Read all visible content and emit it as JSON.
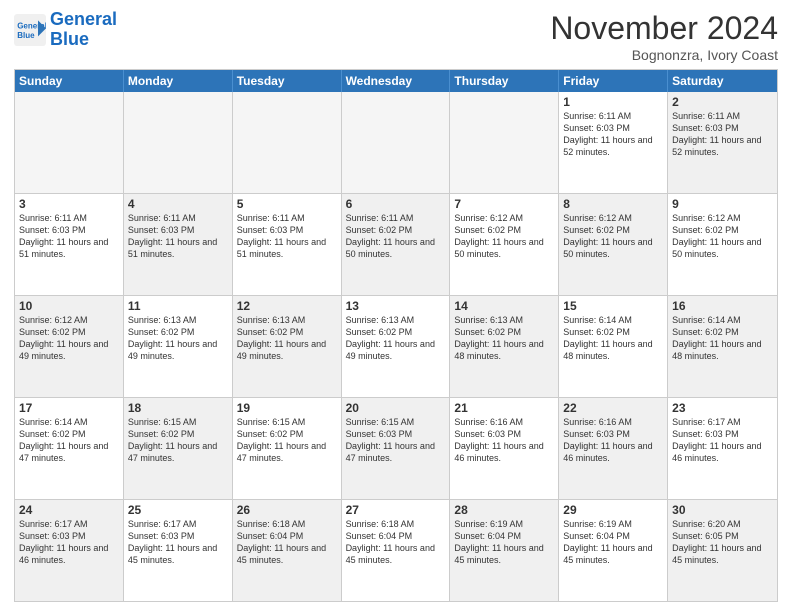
{
  "header": {
    "logo_line1": "General",
    "logo_line2": "Blue",
    "month_title": "November 2024",
    "location": "Bognonzra, Ivory Coast"
  },
  "weekdays": [
    "Sunday",
    "Monday",
    "Tuesday",
    "Wednesday",
    "Thursday",
    "Friday",
    "Saturday"
  ],
  "rows": [
    [
      {
        "day": "",
        "empty": true
      },
      {
        "day": "",
        "empty": true
      },
      {
        "day": "",
        "empty": true
      },
      {
        "day": "",
        "empty": true
      },
      {
        "day": "",
        "empty": true
      },
      {
        "day": "1",
        "sunrise": "6:11 AM",
        "sunset": "6:03 PM",
        "daylight": "11 hours and 52 minutes."
      },
      {
        "day": "2",
        "sunrise": "6:11 AM",
        "sunset": "6:03 PM",
        "daylight": "11 hours and 52 minutes.",
        "shaded": true
      }
    ],
    [
      {
        "day": "3",
        "sunrise": "6:11 AM",
        "sunset": "6:03 PM",
        "daylight": "11 hours and 51 minutes."
      },
      {
        "day": "4",
        "sunrise": "6:11 AM",
        "sunset": "6:03 PM",
        "daylight": "11 hours and 51 minutes.",
        "shaded": true
      },
      {
        "day": "5",
        "sunrise": "6:11 AM",
        "sunset": "6:03 PM",
        "daylight": "11 hours and 51 minutes."
      },
      {
        "day": "6",
        "sunrise": "6:11 AM",
        "sunset": "6:02 PM",
        "daylight": "11 hours and 50 minutes.",
        "shaded": true
      },
      {
        "day": "7",
        "sunrise": "6:12 AM",
        "sunset": "6:02 PM",
        "daylight": "11 hours and 50 minutes."
      },
      {
        "day": "8",
        "sunrise": "6:12 AM",
        "sunset": "6:02 PM",
        "daylight": "11 hours and 50 minutes.",
        "shaded": true
      },
      {
        "day": "9",
        "sunrise": "6:12 AM",
        "sunset": "6:02 PM",
        "daylight": "11 hours and 50 minutes."
      }
    ],
    [
      {
        "day": "10",
        "sunrise": "6:12 AM",
        "sunset": "6:02 PM",
        "daylight": "11 hours and 49 minutes.",
        "shaded": true
      },
      {
        "day": "11",
        "sunrise": "6:13 AM",
        "sunset": "6:02 PM",
        "daylight": "11 hours and 49 minutes."
      },
      {
        "day": "12",
        "sunrise": "6:13 AM",
        "sunset": "6:02 PM",
        "daylight": "11 hours and 49 minutes.",
        "shaded": true
      },
      {
        "day": "13",
        "sunrise": "6:13 AM",
        "sunset": "6:02 PM",
        "daylight": "11 hours and 49 minutes."
      },
      {
        "day": "14",
        "sunrise": "6:13 AM",
        "sunset": "6:02 PM",
        "daylight": "11 hours and 48 minutes.",
        "shaded": true
      },
      {
        "day": "15",
        "sunrise": "6:14 AM",
        "sunset": "6:02 PM",
        "daylight": "11 hours and 48 minutes."
      },
      {
        "day": "16",
        "sunrise": "6:14 AM",
        "sunset": "6:02 PM",
        "daylight": "11 hours and 48 minutes.",
        "shaded": true
      }
    ],
    [
      {
        "day": "17",
        "sunrise": "6:14 AM",
        "sunset": "6:02 PM",
        "daylight": "11 hours and 47 minutes."
      },
      {
        "day": "18",
        "sunrise": "6:15 AM",
        "sunset": "6:02 PM",
        "daylight": "11 hours and 47 minutes.",
        "shaded": true
      },
      {
        "day": "19",
        "sunrise": "6:15 AM",
        "sunset": "6:02 PM",
        "daylight": "11 hours and 47 minutes."
      },
      {
        "day": "20",
        "sunrise": "6:15 AM",
        "sunset": "6:03 PM",
        "daylight": "11 hours and 47 minutes.",
        "shaded": true
      },
      {
        "day": "21",
        "sunrise": "6:16 AM",
        "sunset": "6:03 PM",
        "daylight": "11 hours and 46 minutes."
      },
      {
        "day": "22",
        "sunrise": "6:16 AM",
        "sunset": "6:03 PM",
        "daylight": "11 hours and 46 minutes.",
        "shaded": true
      },
      {
        "day": "23",
        "sunrise": "6:17 AM",
        "sunset": "6:03 PM",
        "daylight": "11 hours and 46 minutes."
      }
    ],
    [
      {
        "day": "24",
        "sunrise": "6:17 AM",
        "sunset": "6:03 PM",
        "daylight": "11 hours and 46 minutes.",
        "shaded": true
      },
      {
        "day": "25",
        "sunrise": "6:17 AM",
        "sunset": "6:03 PM",
        "daylight": "11 hours and 45 minutes."
      },
      {
        "day": "26",
        "sunrise": "6:18 AM",
        "sunset": "6:04 PM",
        "daylight": "11 hours and 45 minutes.",
        "shaded": true
      },
      {
        "day": "27",
        "sunrise": "6:18 AM",
        "sunset": "6:04 PM",
        "daylight": "11 hours and 45 minutes."
      },
      {
        "day": "28",
        "sunrise": "6:19 AM",
        "sunset": "6:04 PM",
        "daylight": "11 hours and 45 minutes.",
        "shaded": true
      },
      {
        "day": "29",
        "sunrise": "6:19 AM",
        "sunset": "6:04 PM",
        "daylight": "11 hours and 45 minutes."
      },
      {
        "day": "30",
        "sunrise": "6:20 AM",
        "sunset": "6:05 PM",
        "daylight": "11 hours and 45 minutes.",
        "shaded": true
      }
    ]
  ]
}
